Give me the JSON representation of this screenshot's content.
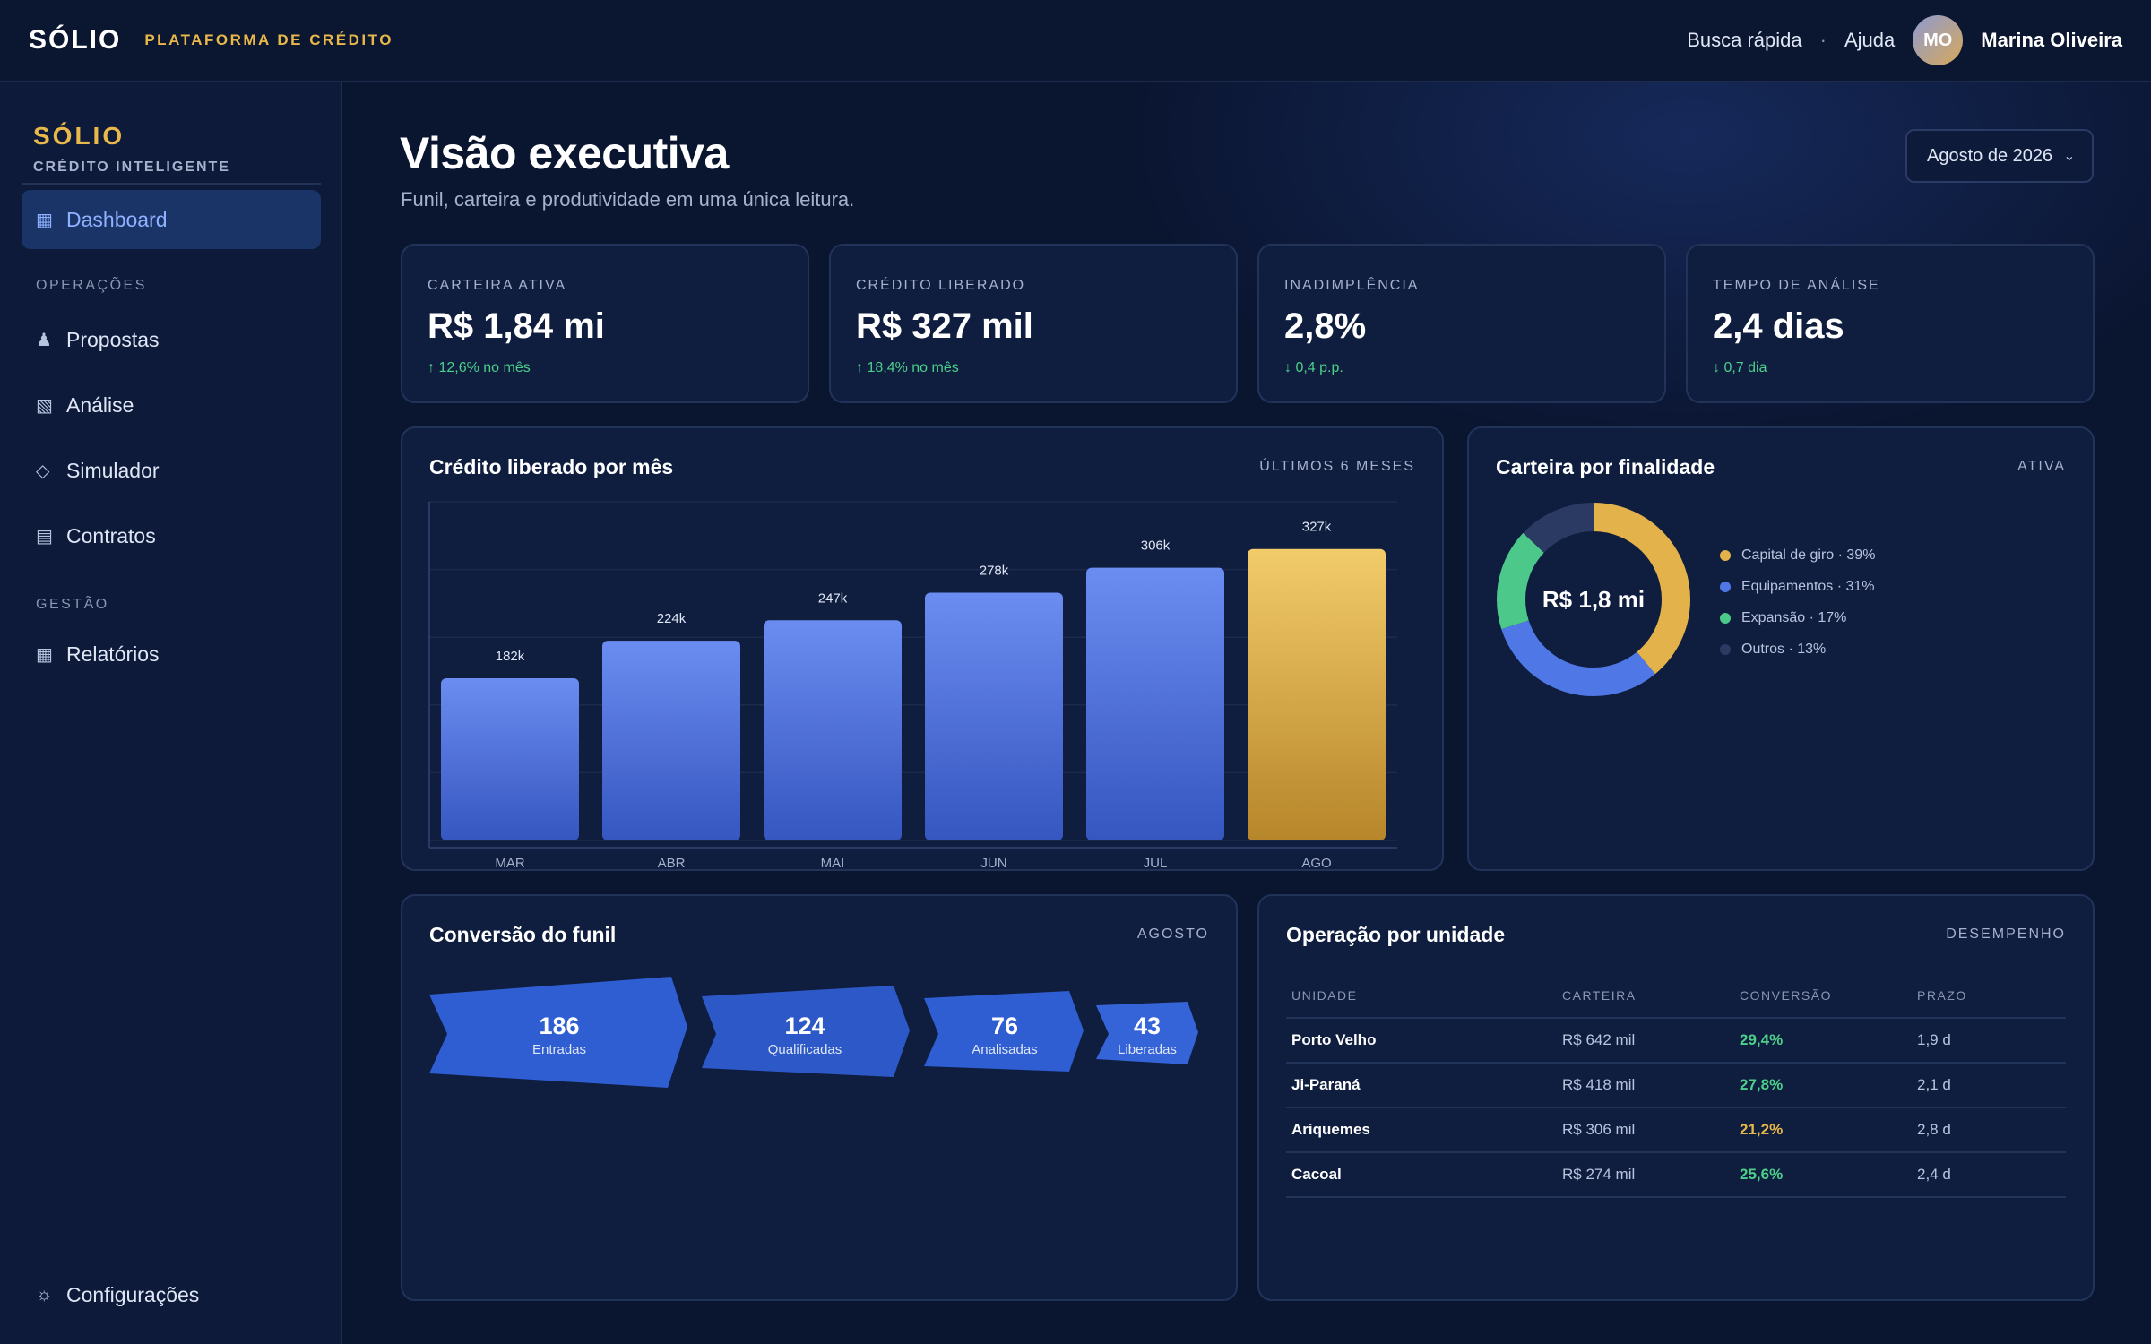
{
  "topbar": {
    "brand": "SÓLIO",
    "brand_sub": "PLATAFORMA DE CRÉDITO",
    "quick_search": "Busca rápida",
    "separator": "·",
    "help": "Ajuda",
    "avatar_initials": "MO",
    "user_name": "Marina Oliveira"
  },
  "sidebar": {
    "brand": "SÓLIO",
    "brand_sub": "CRÉDITO INTELIGENTE",
    "dashboard": {
      "label": "Dashboard",
      "icon": "grid-icon"
    },
    "section_ops": "OPERAÇÕES",
    "ops_items": [
      {
        "label": "Propostas",
        "icon": "person-icon"
      },
      {
        "label": "Análise",
        "icon": "hatched-square-icon"
      },
      {
        "label": "Simulador",
        "icon": "diamond-icon"
      },
      {
        "label": "Contratos",
        "icon": "list-icon"
      }
    ],
    "section_mgmt": "GESTÃO",
    "mgmt_items": [
      {
        "label": "Relatórios",
        "icon": "table-icon"
      }
    ],
    "settings": {
      "label": "Configurações",
      "icon": "gear-icon"
    }
  },
  "header": {
    "title": "Visão executiva",
    "subtitle": "Funil, carteira e produtividade em uma única leitura.",
    "period": "Agosto de 2026",
    "period_chevron": "⌄"
  },
  "kpis": [
    {
      "label": "CARTEIRA ATIVA",
      "value": "R$ 1,84 mi",
      "delta": "↑ 12,6% no mês"
    },
    {
      "label": "CRÉDITO LIBERADO",
      "value": "R$ 327 mil",
      "delta": "↑ 18,4% no mês"
    },
    {
      "label": "INADIMPLÊNCIA",
      "value": "2,8%",
      "delta": "↓ 0,4 p.p."
    },
    {
      "label": "TEMPO DE ANÁLISE",
      "value": "2,4 dias",
      "delta": "↓ 0,7 dia"
    }
  ],
  "bar_card": {
    "title": "Crédito liberado por mês",
    "tag": "ÚLTIMOS 6 MESES"
  },
  "donut_card": {
    "title": "Carteira por finalidade",
    "tag": "ATIVA",
    "center_label": "R$ 1,8 mi"
  },
  "funnel_card": {
    "title": "Conversão do funil",
    "tag": "AGOSTO"
  },
  "funnel": [
    {
      "value": "186",
      "label": "Entradas"
    },
    {
      "value": "124",
      "label": "Qualificadas"
    },
    {
      "value": "76",
      "label": "Analisadas"
    },
    {
      "value": "43",
      "label": "Liberadas"
    }
  ],
  "units_card": {
    "title": "Operação por unidade",
    "tag": "DESEMPENHO",
    "columns": [
      "UNIDADE",
      "CARTEIRA",
      "CONVERSÃO",
      "PRAZO"
    ],
    "rows": [
      {
        "unit": "Porto Velho",
        "portfolio": "R$ 642 mil",
        "conversion": "29,4%",
        "term": "1,9 d",
        "conv_color": "#4cd08a"
      },
      {
        "unit": "Ji-Paraná",
        "portfolio": "R$ 418 mil",
        "conversion": "27,8%",
        "term": "2,1 d",
        "conv_color": "#4cd08a"
      },
      {
        "unit": "Ariquemes",
        "portfolio": "R$ 306 mil",
        "conversion": "21,2%",
        "term": "2,8 d",
        "conv_color": "#e9b84a"
      },
      {
        "unit": "Cacoal",
        "portfolio": "R$ 274 mil",
        "conversion": "25,6%",
        "term": "2,4 d",
        "conv_color": "#4cd08a"
      }
    ]
  },
  "colors": {
    "accent_gold": "#e9b84a",
    "accent_blue": "#4f78e6",
    "positive": "#4cd08a",
    "bar_blue_top": "#6b8cf0",
    "bar_blue_bottom": "#3656c0"
  },
  "chart_data": [
    {
      "type": "bar",
      "title": "Crédito liberado por mês",
      "categories": [
        "MAR",
        "ABR",
        "MAI",
        "JUN",
        "JUL",
        "AGO"
      ],
      "values": [
        182,
        224,
        247,
        278,
        306,
        327
      ],
      "value_labels": [
        "182k",
        "224k",
        "247k",
        "278k",
        "306k",
        "327k"
      ],
      "highlight": "AGO",
      "ylim": [
        0,
        380
      ],
      "grid": true
    },
    {
      "type": "pie",
      "title": "Carteira por finalidade",
      "labels": [
        "Capital de giro · 39%",
        "Equipamentos · 31%",
        "Expansão · 17%",
        "Outros · 13%"
      ],
      "values": [
        39,
        31,
        17,
        13
      ],
      "colors": [
        "#e4b24a",
        "#4f78e6",
        "#4cc98a",
        "#2a3a62"
      ],
      "legend": "right"
    }
  ]
}
